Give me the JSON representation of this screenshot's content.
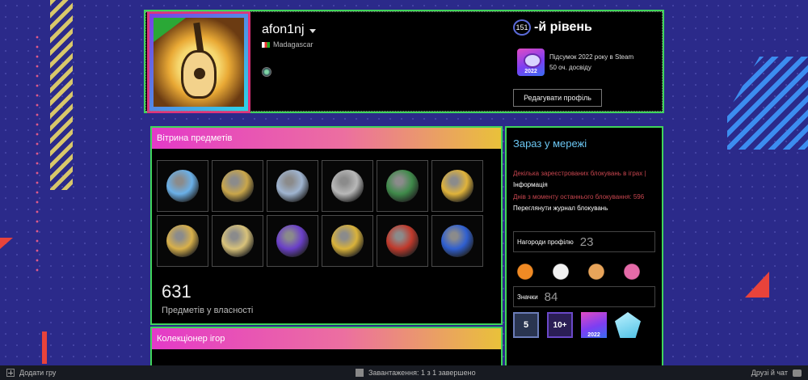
{
  "profile": {
    "username": "afon1nj",
    "country": "Madagascar",
    "level_number": "151",
    "level_suffix": "-й рівень",
    "summary_title": "Підсумок 2022 року в Steam",
    "summary_points": "50 оч. досвіду",
    "summary_badge_year": "2022",
    "edit_button": "Редагувати профіль"
  },
  "showcase": {
    "title": "Вітрина предметів",
    "items": [
      {
        "icon": "diamond-pin-icon",
        "color": "#6ab0e8"
      },
      {
        "icon": "star-eagle-medal-icon",
        "color": "#c9a64a"
      },
      {
        "icon": "crossed-swords-medal-icon",
        "color": "#9fb4d0"
      },
      {
        "icon": "silver-coin-icon",
        "color": "#b8b8b8"
      },
      {
        "icon": "snake-coin-icon",
        "color": "#3f8a4a"
      },
      {
        "icon": "gold-snake-icon",
        "color": "#e0b33a"
      },
      {
        "icon": "gold-star-medal-icon",
        "color": "#d8b04a"
      },
      {
        "icon": "silver-star-medal-icon",
        "color": "#d8c27a"
      },
      {
        "icon": "purple-crystal-icon",
        "color": "#6a3fc8"
      },
      {
        "icon": "gold-coin-icon",
        "color": "#d9b23a"
      },
      {
        "icon": "red-dog-coin-icon",
        "color": "#c0392b"
      },
      {
        "icon": "blue-star-medal-icon",
        "color": "#2f5fd0"
      }
    ],
    "count": "631",
    "count_label": "Предметів у власності"
  },
  "collector": {
    "title": "Колекціонер ігор"
  },
  "sidebar": {
    "online": "Зараз у мережі",
    "ban_line1": "Декілька зареєстрованих блокувань в іграх |",
    "ban_info": "Інформація",
    "ban_line2": "Днів з моменту останнього блокування: 596",
    "ban_log": "Переглянути журнал блокувань",
    "awards_label": "Нагороди профілю",
    "awards_count": "23",
    "awards": [
      "fox-award-icon",
      "bee-award-icon",
      "horse-award-icon",
      "cat-award-icon"
    ],
    "badges_label": "Значки",
    "badges_count": "84",
    "badges": [
      {
        "name": "years-badge",
        "text": "5"
      },
      {
        "name": "games-badge",
        "text": "10+"
      },
      {
        "name": "year-review-badge",
        "text": "2022"
      },
      {
        "name": "crystal-badge",
        "text": ""
      }
    ]
  },
  "footer": {
    "add_game": "Додати гру",
    "downloads": "Завантаження: 1 з 1 завершено",
    "friends_chat": "Друзі й чат"
  }
}
